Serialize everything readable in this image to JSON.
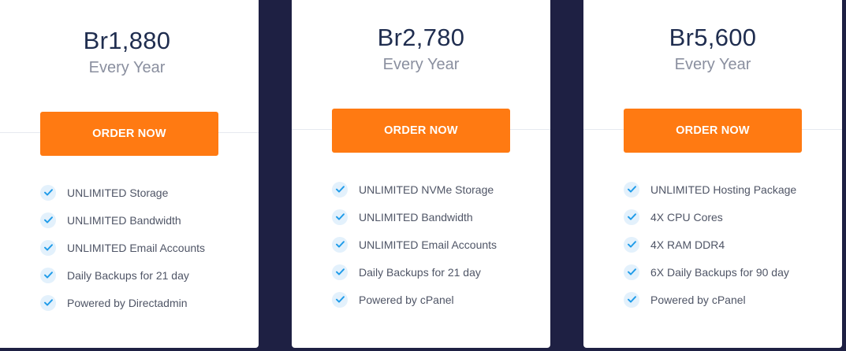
{
  "plans": [
    {
      "price": "Br1,880",
      "period": "Every Year",
      "button_label": "ORDER NOW",
      "features": [
        "UNLIMITED Storage",
        "UNLIMITED Bandwidth",
        "UNLIMITED Email Accounts",
        "Daily Backups for 21 day",
        "Powered by Directadmin"
      ]
    },
    {
      "price": "Br2,780",
      "period": "Every Year",
      "button_label": "ORDER NOW",
      "features": [
        "UNLIMITED NVMe Storage",
        "UNLIMITED Bandwidth",
        "UNLIMITED Email Accounts",
        "Daily Backups for 21 day",
        "Powered by cPanel"
      ]
    },
    {
      "price": "Br5,600",
      "period": "Every Year",
      "button_label": "ORDER NOW",
      "features": [
        "UNLIMITED Hosting Package",
        "4X CPU Cores",
        "4X RAM DDR4",
        "6X Daily Backups for 90 day",
        "Powered by cPanel"
      ]
    }
  ],
  "colors": {
    "background": "#1e2043",
    "button": "#ff7a12",
    "price_text": "#1f2d4f",
    "check": "#1e9be9"
  },
  "icons": {
    "feature_icon": "check-circle-icon"
  }
}
